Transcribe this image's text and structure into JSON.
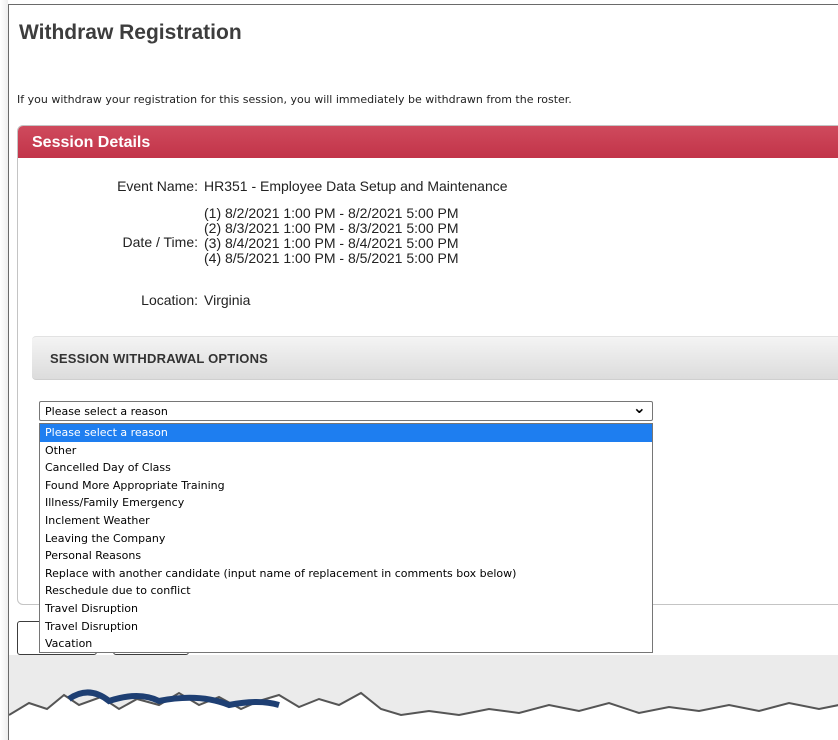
{
  "page": {
    "title": "Withdraw Registration",
    "intro": "If you withdraw your registration for this session, you will immediately be withdrawn from the roster."
  },
  "session_details": {
    "header": "Session Details",
    "event_name_label": "Event Name:",
    "event_name": "HR351 - Employee Data Setup and Maintenance",
    "date_time_label": "Date / Time:",
    "dates": [
      "(1) 8/2/2021 1:00 PM - 8/2/2021 5:00 PM",
      "(2) 8/3/2021 1:00 PM - 8/3/2021 5:00 PM",
      "(3) 8/4/2021 1:00 PM - 8/4/2021 5:00 PM",
      "(4) 8/5/2021 1:00 PM - 8/5/2021 5:00 PM"
    ],
    "location_label": "Location:",
    "location": "Virginia"
  },
  "withdrawal": {
    "header": "SESSION WITHDRAWAL OPTIONS",
    "select_value": "Please select a reason",
    "options": [
      "Please select a reason",
      "Other",
      "Cancelled Day of Class",
      "Found More Appropriate Training",
      "Illness/Family Emergency",
      "Inclement Weather",
      "Leaving the Company",
      "Personal Reasons",
      "Replace with another candidate (input name of replacement in comments box below)",
      "Reschedule due to conflict",
      "Travel Disruption",
      "Travel Disruption",
      "Vacation"
    ],
    "highlighted_index": 0
  },
  "colors": {
    "header_red": "#c8394e",
    "selected_blue": "#1e7ef0"
  }
}
